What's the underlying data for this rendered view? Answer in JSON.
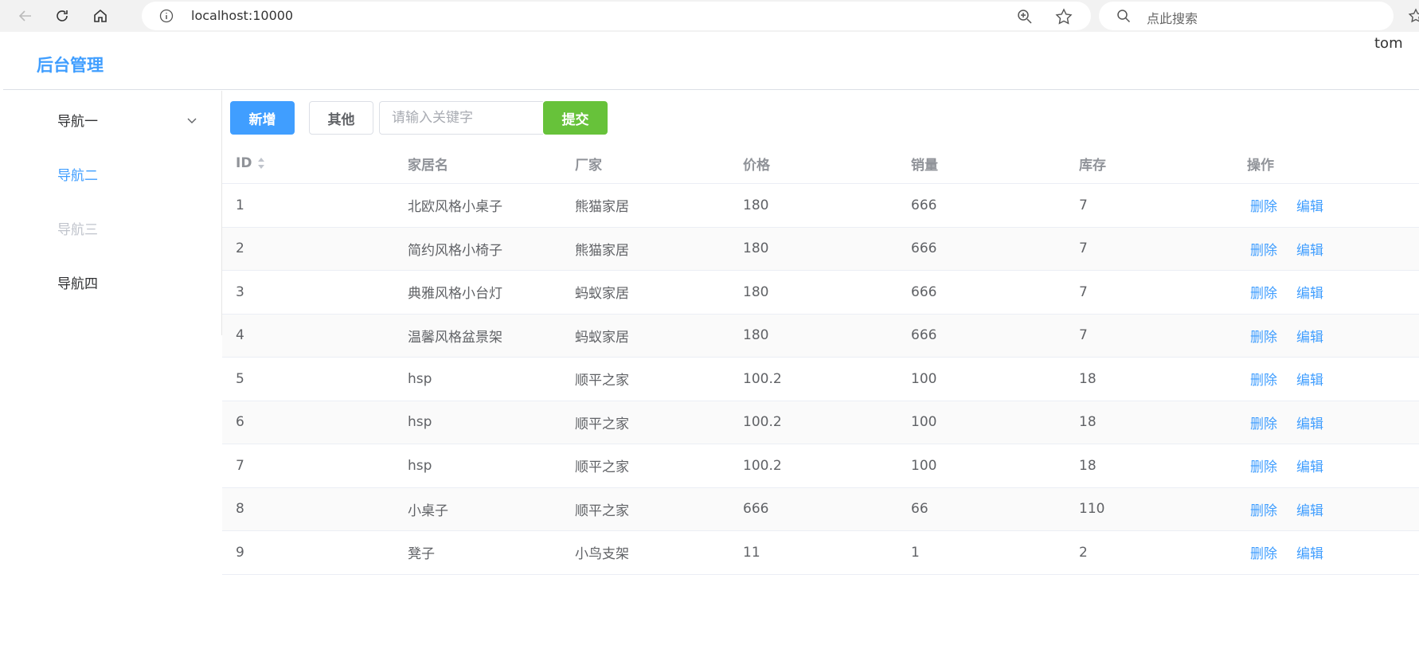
{
  "browser": {
    "url": "localhost:10000",
    "search_placeholder": "点此搜索"
  },
  "header": {
    "brand": "后台管理",
    "user": "tom"
  },
  "sidebar": {
    "items": [
      {
        "label": "导航一",
        "state": "submenu"
      },
      {
        "label": "导航二",
        "state": "active"
      },
      {
        "label": "导航三",
        "state": "disabled"
      },
      {
        "label": "导航四",
        "state": "normal"
      }
    ]
  },
  "toolbar": {
    "add_label": "新增",
    "other_label": "其他",
    "keyword_placeholder": "请输入关键字",
    "submit_label": "提交"
  },
  "table": {
    "columns": [
      "ID",
      "家居名",
      "厂家",
      "价格",
      "销量",
      "库存",
      "操作"
    ],
    "delete_label": "删除",
    "edit_label": "编辑",
    "rows": [
      [
        "1",
        "北欧风格小桌子",
        "熊猫家居",
        "180",
        "666",
        "7"
      ],
      [
        "2",
        "简约风格小椅子",
        "熊猫家居",
        "180",
        "666",
        "7"
      ],
      [
        "3",
        "典雅风格小台灯",
        "蚂蚁家居",
        "180",
        "666",
        "7"
      ],
      [
        "4",
        "温馨风格盆景架",
        "蚂蚁家居",
        "180",
        "666",
        "7"
      ],
      [
        "5",
        "hsp",
        "顺平之家",
        "100.2",
        "100",
        "18"
      ],
      [
        "6",
        "hsp",
        "顺平之家",
        "100.2",
        "100",
        "18"
      ],
      [
        "7",
        "hsp",
        "顺平之家",
        "100.2",
        "100",
        "18"
      ],
      [
        "8",
        "小桌子",
        "顺平之家",
        "666",
        "66",
        "110"
      ],
      [
        "9",
        "凳子",
        "小鸟支架",
        "11",
        "1",
        "2"
      ]
    ]
  },
  "colors": {
    "primary": "#409eff",
    "success": "#67c23a",
    "disabled_text": "#c0c4cc",
    "text": "#303133"
  }
}
